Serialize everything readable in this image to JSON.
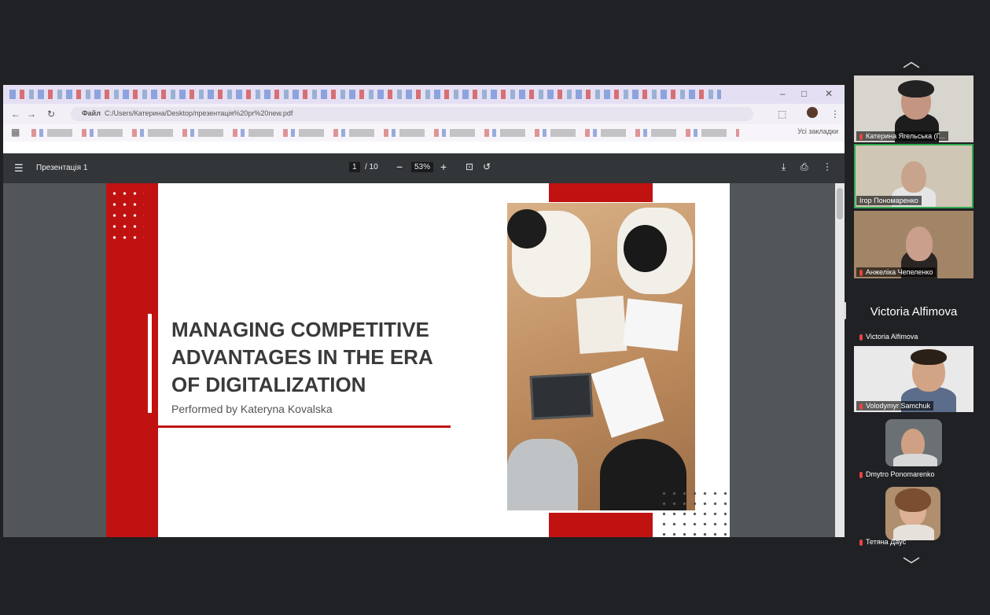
{
  "browser": {
    "url": "C:/Users/Катерина/Desktop/презентація%20pr%20new.pdf",
    "site_badge": "Файл",
    "bookmarks_folder": "Усі закладки",
    "bookmarks": [
      "Grammarly",
      "Trello",
      "AUTOCEX",
      "LinkedIn",
      "EUROPASS",
      "EuropeanYouthPortal",
      "VisitsEuropeTalks",
      "Gmail",
      "Outlook",
      "Microsoft 365"
    ]
  },
  "pdf": {
    "title": "Презентація 1",
    "page_current": "1",
    "page_total": "/ 10",
    "zoom": "53%"
  },
  "slide": {
    "title_line1": "MANAGING COMPETITIVE",
    "title_line2": "ADVANTAGES IN THE ERA",
    "title_line3": "OF DIGITALIZATION",
    "subtitle": "Performed by Kateryna Kovalska"
  },
  "participants": {
    "p1": "Катерина Ягельська (Г...",
    "p2": "Ігор Пономаренко",
    "p3": "Анжеліка Чепеленко",
    "p4_big": "Victoria Alfimova",
    "p4": "Victoria Alfimova",
    "p5": "Volodymyr Samchuk",
    "p6": "Dmytro Ponomarenko",
    "p7": "Тетяна Даус"
  },
  "colors": {
    "accent_red": "#c11212",
    "active_speaker": "#34a853"
  }
}
